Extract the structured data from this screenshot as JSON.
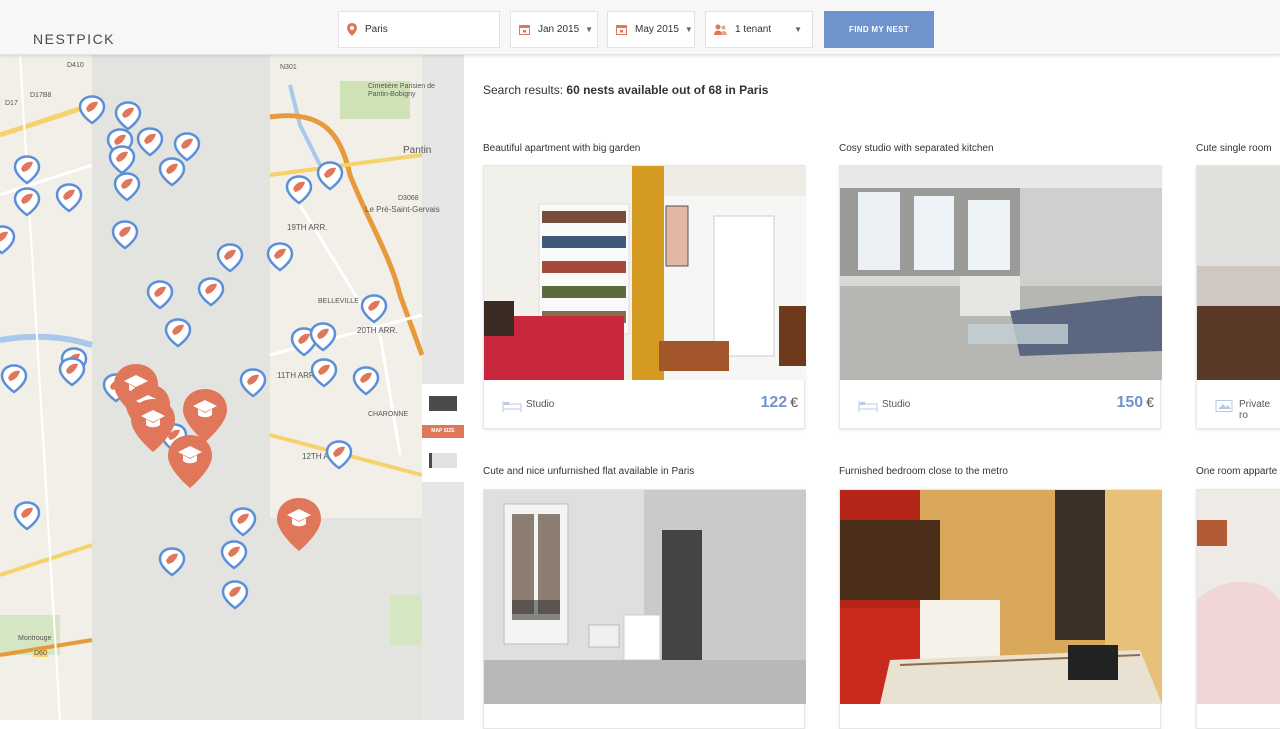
{
  "header": {
    "logo": "NESTPICK",
    "location": "Paris",
    "move_in": "Jan 2015",
    "move_out": "May 2015",
    "tenants": "1 tenant",
    "find_button": "FIND MY NEST",
    "accent_color": "#6f93cc"
  },
  "map": {
    "size_toggle_label": "MAP SIZE",
    "labels": [
      "D410",
      "N301",
      "Cimetière Parisien de Pantin-Bobigny",
      "D17",
      "D17B8",
      "Pantin",
      "D3068",
      "Le Pré-Saint-Gervais",
      "19TH ARR.",
      "20TH ARR.",
      "11TH ARR.",
      "12TH ARR.",
      "Montrouge",
      "BELLEVILLE",
      "CHARONNE",
      "D60"
    ],
    "pin_colors": {
      "listing": "#5b8fd9",
      "university": "#e0775a"
    }
  },
  "results": {
    "summary_prefix": "Search results:",
    "summary_bold": "60 nests available out of 68 in Paris",
    "cards": [
      {
        "title": "Beautiful apartment with big garden",
        "type": "Studio",
        "price": "122",
        "currency": "€"
      },
      {
        "title": "Cosy studio with separated kitchen",
        "type": "Studio",
        "price": "150",
        "currency": "€"
      },
      {
        "title": "Cute single room",
        "type": "Private ro",
        "price": "",
        "currency": ""
      },
      {
        "title": "Cute and nice unfurnished flat available in Paris",
        "type": "",
        "price": "",
        "currency": ""
      },
      {
        "title": "Furnished bedroom close to the metro",
        "type": "",
        "price": "",
        "currency": ""
      },
      {
        "title": "One room apparte",
        "type": "",
        "price": "",
        "currency": ""
      }
    ]
  }
}
